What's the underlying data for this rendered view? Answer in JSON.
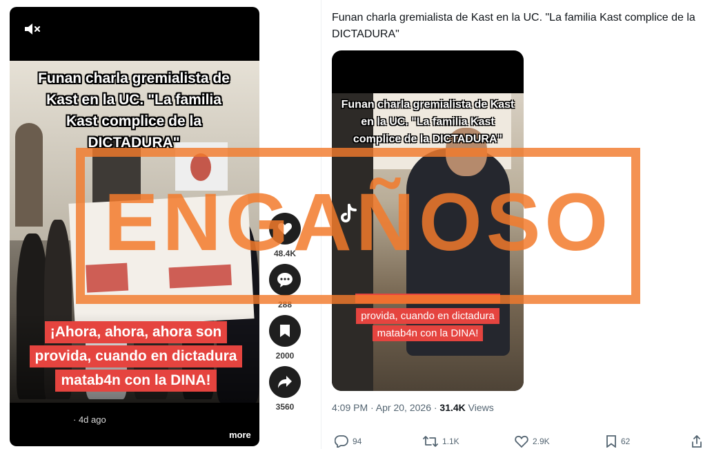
{
  "tiktok": {
    "caption": "Funan charla gremialista de Kast en la UC. \"La familia Kast complice de la DICTADURA\"",
    "subtitle_lines": [
      "¡Ahora, ahora, ahora son",
      "provida, cuando en dictadura",
      "matab4n con la DINA!"
    ],
    "rail": {
      "likes": "48.4K",
      "comments": "288",
      "saves": "2000",
      "shares": "3560"
    },
    "date": "· 4d ago",
    "more_label": "more"
  },
  "post": {
    "text": "Funan charla gremialista de Kast en la UC. \"La familia Kast complice de la DICTADURA\"",
    "embed_caption": "Funan charla gremialista de Kast en la UC. \"La familia Kast complice de la DICTADURA\"",
    "embed_subtitle_lines": [
      "provida, cuando en dictadura",
      "matab4n con la DINA!"
    ],
    "time": "4:09 PM · Apr 20, 2026 · ",
    "views_count": "31.4K",
    "views_label": " Views",
    "actions": {
      "replies": "94",
      "reposts": "1.1K",
      "likes": "2.9K",
      "bookmarks": "62"
    }
  },
  "stamp": {
    "label": "ENGAÑOSO",
    "color": "#F27A2C"
  },
  "colors": {
    "subtitle_bg": "#E5443F",
    "text_primary": "#0F1419",
    "text_secondary": "#536471"
  },
  "icons": [
    "mute-icon",
    "heart-icon",
    "comment-icon",
    "bookmark-icon",
    "share-icon",
    "tiktok-logo-icon",
    "reply-icon",
    "repost-icon",
    "like-icon",
    "x-bookmark-icon",
    "x-share-icon"
  ]
}
